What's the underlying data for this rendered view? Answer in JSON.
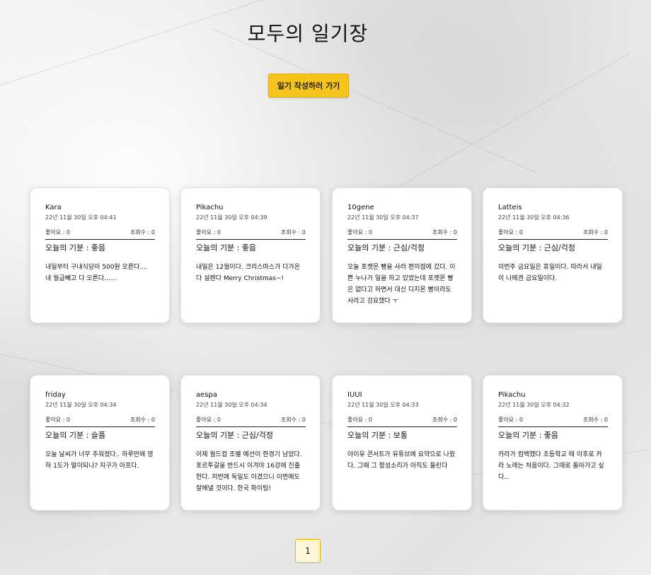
{
  "header": {
    "title": "모두의 일기장",
    "write_button": "일기 작성하러 가기"
  },
  "diaries": [
    {
      "author": "Kara",
      "date": "22년 11월 30일 오후 04:41",
      "likes": "좋아요 : 0",
      "views": "조회수 : 0",
      "mood": "오늘의 기분 : 좋음",
      "body": "내일부터 구내식당이 500원 오른다.... 내 월급빼고 다 오른다......"
    },
    {
      "author": "Pikachu",
      "date": "22년 11월 30일 오후 04:39",
      "likes": "좋아요 : 0",
      "views": "조회수 : 0",
      "mood": "오늘의 기분 : 좋음",
      "body": "내일은 12월이다. 크리스마스가 다가온다 설렌다 Merry Christmas~!"
    },
    {
      "author": "10gene",
      "date": "22년 11월 30일 오후 04:37",
      "likes": "좋아요 : 0",
      "views": "조회수 : 0",
      "mood": "오늘의 기분 : 근심/걱정",
      "body": "오늘 포켓몬 빵을 사러 편의점에 갔다. 이쁜 누나가 일을 하고 있었는데 포켓몬 빵은 없다고 하면서 대신 디지몬 빵이라도 사라고 강요했다 ㅜ"
    },
    {
      "author": "Latteis",
      "date": "22년 11월 30일 오후 04:36",
      "likes": "좋아요 : 0",
      "views": "조회수 : 0",
      "mood": "오늘의 기분 : 근심/걱정",
      "body": "이번주 금요일은 휴일이다. 따라서 내일이 나에겐 금요일이다."
    },
    {
      "author": "friday",
      "date": "22년 11월 30일 오후 04:34",
      "likes": "좋아요 : 0",
      "views": "조회수 : 0",
      "mood": "오늘의 기분 : 슬픔",
      "body": "오늘 날씨가 너무 추워졌다.. 하루만에 영하 1도가 말이되나? 지구가 아프다."
    },
    {
      "author": "aespa",
      "date": "22년 11월 30일 오후 04:34",
      "likes": "좋아요 : 0",
      "views": "조회수 : 0",
      "mood": "오늘의 기분 : 근심/걱정",
      "body": "이제 월드컵 조별 예선이 한경기 남았다. 포르투갈을 반드시 이겨야 16강에 진출한다. 저번에 독일도 이겼으니 이번에도 잘해낼 것이다. 한국 화이팅!"
    },
    {
      "author": "IUUI",
      "date": "22년 11월 30일 오후 04:33",
      "likes": "좋아요 : 0",
      "views": "조회수 : 0",
      "mood": "오늘의 기분 : 보통",
      "body": "아이유 콘서트가 유튜브에 요약으로 나왔다. 그때 그 함성소리가 아직도 들린다"
    },
    {
      "author": "Pikachu",
      "date": "22년 11월 30일 오후 04:32",
      "likes": "좋아요 : 0",
      "views": "조회수 : 0",
      "mood": "오늘의 기분 : 좋음",
      "body": "카라가 컴백했다 초등학교 때 이후로 카라 노래는 처음이다. 그때로 돌아가고 싶다.."
    }
  ],
  "pagination": {
    "current": "1"
  }
}
